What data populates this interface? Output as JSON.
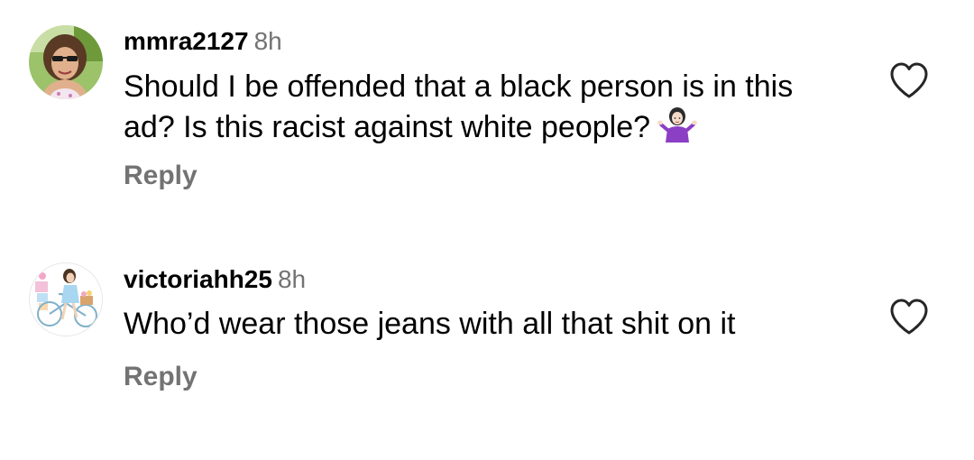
{
  "comments": [
    {
      "username": "mmra2127",
      "time": "8h",
      "text": "Should I be offended that a black person is in this ad? Is this racist against white people?",
      "emoji": "person-shrugging-emoji",
      "reply_label": "Reply",
      "like_icon": "heart-outline-icon",
      "avatar_icon": "avatar-photo"
    },
    {
      "username": "victoriahh25",
      "time": "8h",
      "text": "Who’d wear those jeans with all that shit on it",
      "reply_label": "Reply",
      "like_icon": "heart-outline-icon",
      "avatar_icon": "avatar-illustration"
    }
  ],
  "colors": {
    "text_primary": "#000000",
    "text_secondary": "#737373",
    "background": "#ffffff"
  }
}
